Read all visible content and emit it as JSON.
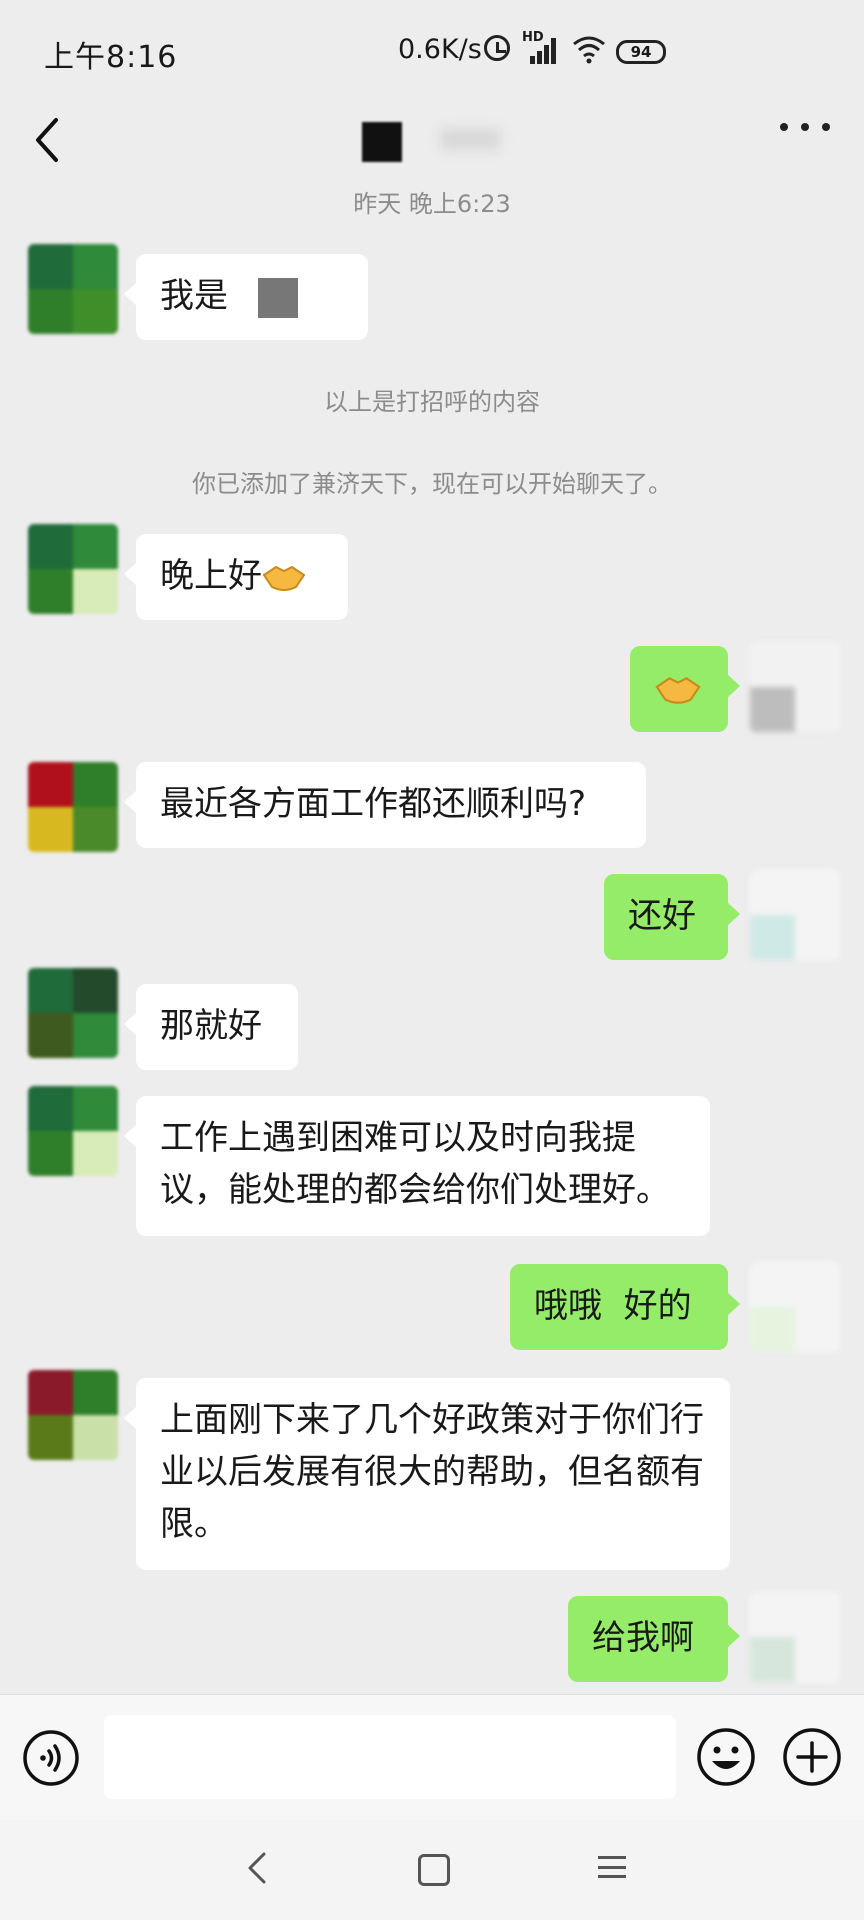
{
  "status_bar": {
    "time": "上午8:16",
    "network_speed": "0.6K/s",
    "hd_label": "HD",
    "battery": "94"
  },
  "header": {
    "back_icon": "chevron-left-icon",
    "more_icon": "more-dots-icon"
  },
  "chat": {
    "date_divider": "昨天 晚上6:23",
    "greeting_notice": "以上是打招呼的内容",
    "added_notice": "你已添加了兼济天下，现在可以开始聊天了。",
    "messages": [
      {
        "side": "left",
        "text": "我是"
      },
      {
        "side": "left",
        "text": "晚上好"
      },
      {
        "side": "right",
        "text": ""
      },
      {
        "side": "left",
        "text": "最近各方面工作都还顺利吗?"
      },
      {
        "side": "right",
        "text": "还好"
      },
      {
        "side": "left",
        "text": "那就好"
      },
      {
        "side": "left",
        "text": "工作上遇到困难可以及时向我提议，能处理的都会给你们处理好。"
      },
      {
        "side": "right",
        "text": "哦哦  好的"
      },
      {
        "side": "left",
        "text": "上面刚下来了几个好政策对于你们行业以后发展有很大的帮助，但名额有限。"
      },
      {
        "side": "right",
        "text": "给我啊"
      }
    ]
  },
  "input_bar": {
    "voice_icon": "voice-icon",
    "input_value": "",
    "emoji_icon": "emoji-icon",
    "plus_icon": "plus-icon"
  },
  "nav_bar": {
    "back": "nav-back-icon",
    "home": "nav-home-icon",
    "menu": "nav-menu-icon"
  },
  "colors": {
    "background": "#ededed",
    "bubble_self": "#95ec69",
    "bubble_other": "#ffffff",
    "system_text": "#8c8c8c"
  }
}
